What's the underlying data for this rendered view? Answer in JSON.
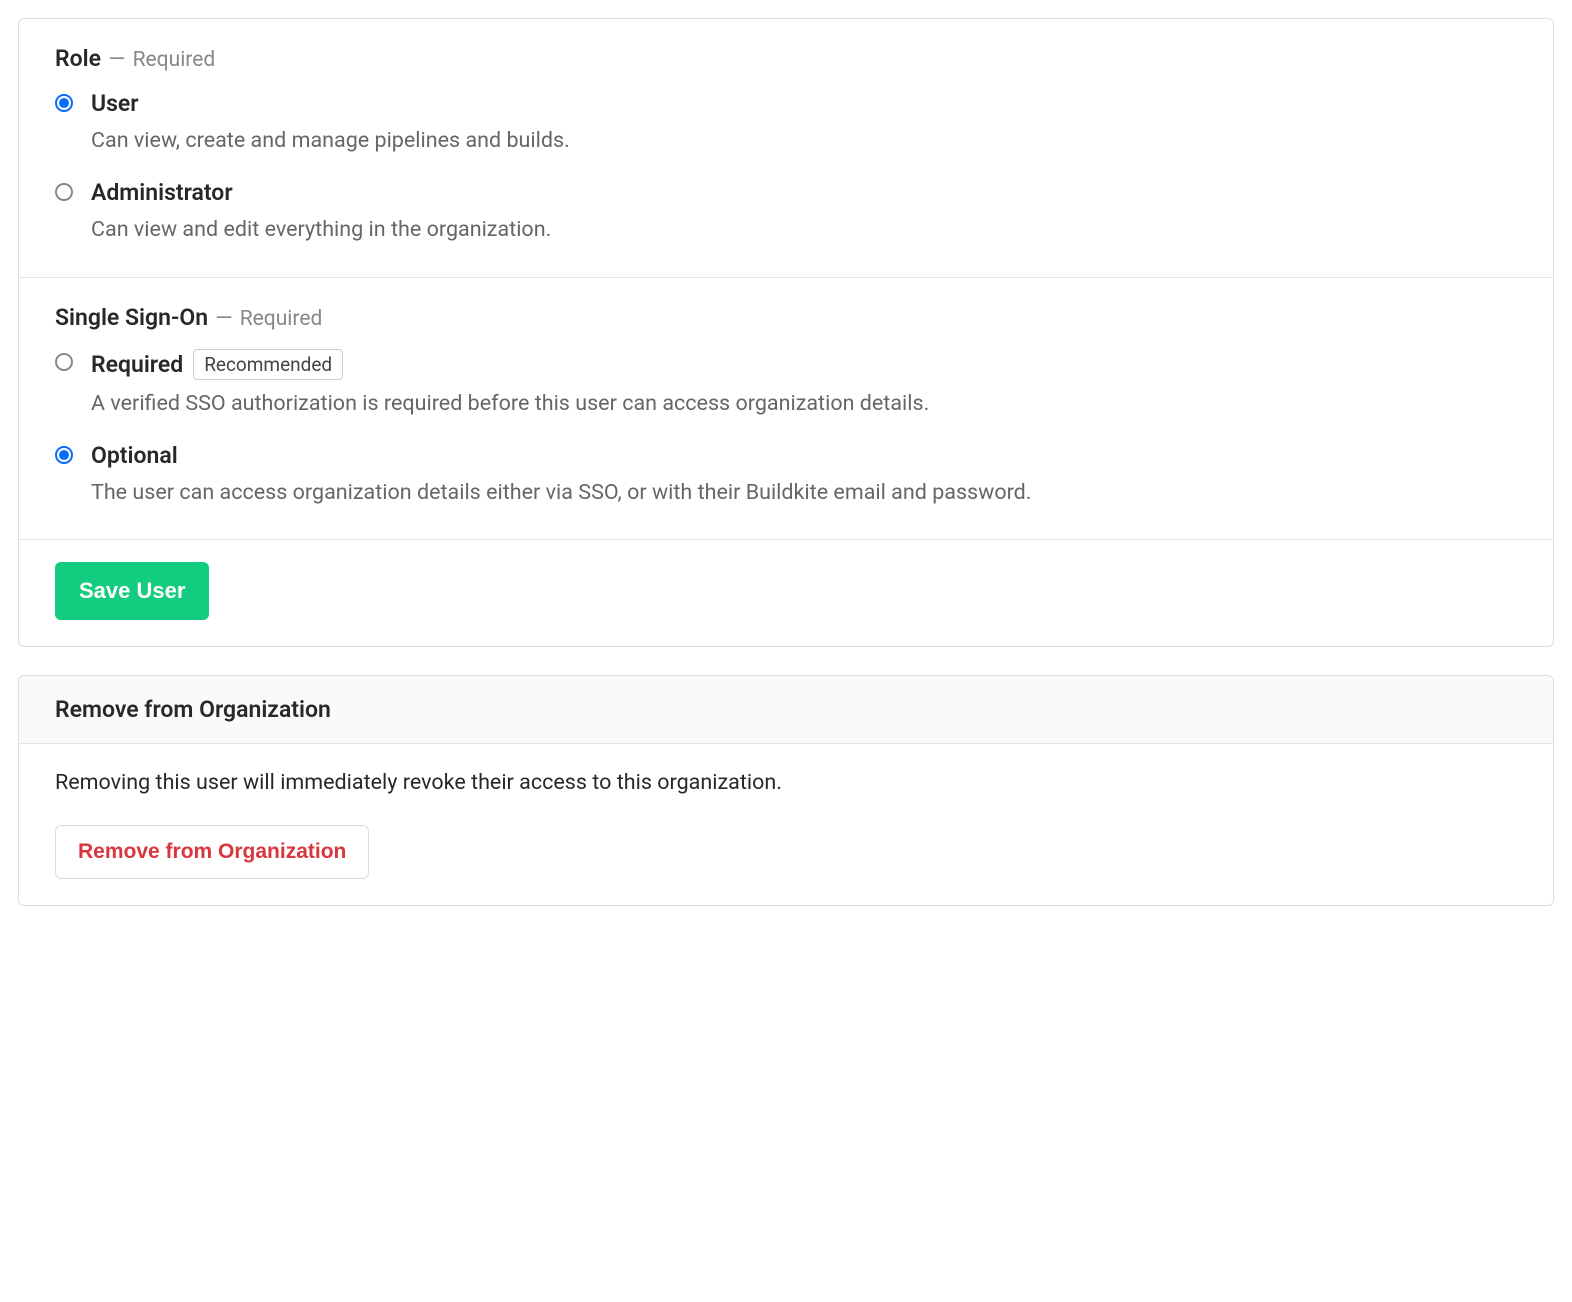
{
  "roleSection": {
    "label": "Role",
    "required": "Required",
    "options": {
      "user": {
        "title": "User",
        "desc": "Can view, create and manage pipelines and builds.",
        "selected": true
      },
      "admin": {
        "title": "Administrator",
        "desc": "Can view and edit everything in the organization.",
        "selected": false
      }
    }
  },
  "ssoSection": {
    "label": "Single Sign-On",
    "required": "Required",
    "options": {
      "required": {
        "title": "Required",
        "badge": "Recommended",
        "desc": "A verified SSO authorization is required before this user can access organization details.",
        "selected": false
      },
      "optional": {
        "title": "Optional",
        "desc": "The user can access organization details either via SSO, or with their Buildkite email and password.",
        "selected": true
      }
    }
  },
  "actions": {
    "saveButton": "Save User"
  },
  "removeSection": {
    "title": "Remove from Organization",
    "body": "Removing this user will immediately revoke their access to this organization.",
    "button": "Remove from Organization"
  },
  "common": {
    "sep": "—"
  }
}
